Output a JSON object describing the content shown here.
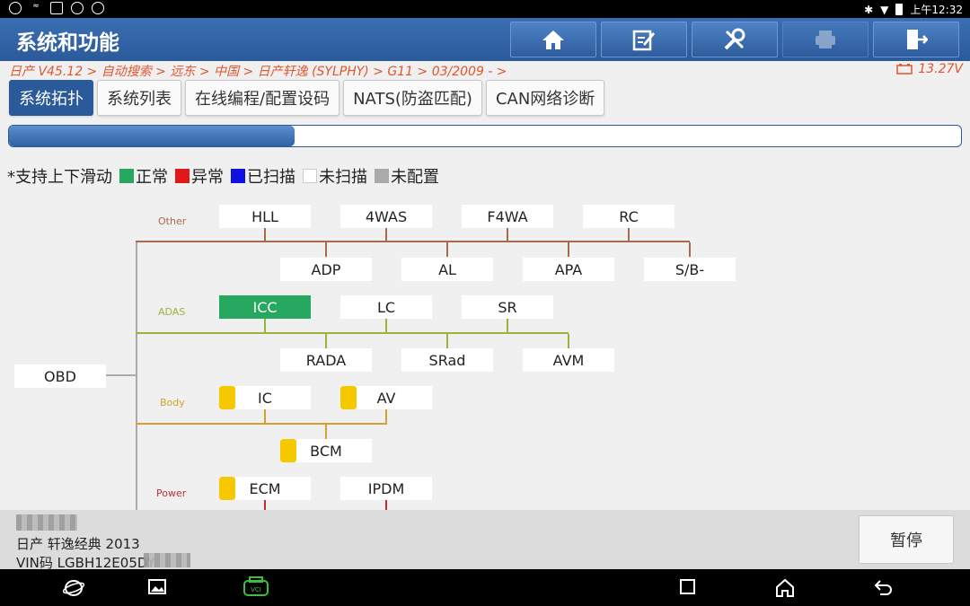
{
  "statusbar": {
    "left_icons": [
      "app-icon",
      "signal-icon",
      "image-icon",
      "compass-icon",
      "bluetooth-icon"
    ],
    "time": "上午12:32"
  },
  "header": {
    "title": "系统和功能"
  },
  "toolbar": {
    "buttons": [
      {
        "icon": "home-icon"
      },
      {
        "icon": "report-edit-icon"
      },
      {
        "icon": "tools-icon"
      },
      {
        "icon": "print-icon"
      },
      {
        "icon": "exit-icon"
      }
    ]
  },
  "breadcrumb": "日产 V45.12 > 自动搜索 > 远东 > 中国 > 日产轩逸 (SYLPHY) > G11 > 03/2009 - >",
  "battery_voltage": "13.27V",
  "tabs": [
    "系统拓扑",
    "系统列表",
    "在线编程/配置设码",
    "NATS(防盗匹配)",
    "CAN网络诊断"
  ],
  "progress": 0.3,
  "legend": {
    "hint": "*支持上下滑动",
    "items": [
      {
        "label": "正常",
        "color": "#27a860"
      },
      {
        "label": "异常",
        "color": "#e01818"
      },
      {
        "label": "已扫描",
        "color": "#1010e0"
      },
      {
        "label": "未扫描",
        "color": "#ffffff"
      },
      {
        "label": "未配置",
        "color": "#aaaaaa"
      }
    ]
  },
  "topology": {
    "root": "OBD",
    "groups": {
      "other": {
        "label": "Other",
        "color": "#a86a4a",
        "top": [
          "HLL",
          "4WAS",
          "F4WA",
          "RC"
        ],
        "bottom": [
          "ADP",
          "AL",
          "APA",
          "S/B-"
        ]
      },
      "adas": {
        "label": "ADAS",
        "color": "#9ab43a",
        "top": [
          "ICC",
          "LC",
          "SR"
        ],
        "bottom": [
          "RADA",
          "SRad",
          "AVM"
        ]
      },
      "body": {
        "label": "Body",
        "color": "#d6a030",
        "top": [
          "IC",
          "AV"
        ],
        "bottom": [
          "BCM"
        ]
      },
      "power": {
        "label": "Power",
        "color": "#c03030",
        "top": [
          "ECM",
          "IPDM"
        ]
      }
    }
  },
  "vehicle": {
    "model": "日产 轩逸经典 2013",
    "vin": "VIN码 LGBH12E05DY"
  },
  "pause_label": "暂停",
  "navbar": {
    "icons": [
      "browser-icon",
      "gallery-icon",
      "vci-icon",
      "recent-apps-icon",
      "home-nav-icon",
      "back-icon"
    ]
  }
}
